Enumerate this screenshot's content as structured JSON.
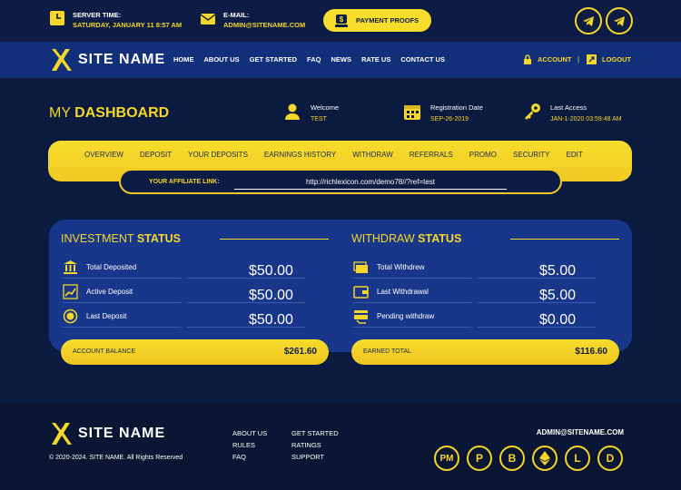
{
  "topbar": {
    "server_time_label": "SERVER TIME:",
    "server_time_value": "SATURDAY, JANUARY 11 8:57 AM",
    "email_label": "E-MAIL:",
    "email_value": "ADMIN@SITENAME.COM",
    "payment_proofs": "PAYMENT PROOFS"
  },
  "brand": {
    "name": "SITE NAME"
  },
  "nav": {
    "items": [
      "HOME",
      "ABOUT US",
      "GET STARTED",
      "FAQ",
      "NEWS",
      "RATE US",
      "CONTACT US"
    ],
    "account": "ACCOUNT",
    "separator": "|",
    "logout": "LOGOUT"
  },
  "dashboard": {
    "title_light": "MY",
    "title_bold": "DASHBOARD",
    "welcome_label": "Welcome",
    "welcome_value": "TEST",
    "reg_label": "Registration Date",
    "reg_value": "SEP-26-2019",
    "last_label": "Last Access",
    "last_value": "JAN-1-2020 03:59:48 AM"
  },
  "tabs": [
    "OVERVIEW",
    "DEPOSIT",
    "YOUR DEPOSITS",
    "EARNINGS HISTORY",
    "WITHDRAW",
    "REFERRALS",
    "PROMO",
    "SECURITY",
    "EDIT"
  ],
  "affiliate": {
    "label": "YOUR AFFILIATE LINK:",
    "link": "http://richlexicon.com/demo78//?ref=test"
  },
  "investment": {
    "title_light": "INVESTMENT",
    "title_bold": "STATUS",
    "rows": [
      {
        "label": "Total Deposited",
        "value": "$50.00",
        "icon": "bank-icon"
      },
      {
        "label": "Active Deposit",
        "value": "$50.00",
        "icon": "growth-chart-icon"
      },
      {
        "label": "Last Deposit",
        "value": "$50.00",
        "icon": "coin-icon"
      }
    ],
    "total_label": "ACCOUNT BALANCE",
    "total_value": "$261.60"
  },
  "withdraw": {
    "title_light": "WITHDRAW",
    "title_bold": "STATUS",
    "rows": [
      {
        "label": "Total Withdrew",
        "value": "$5.00",
        "icon": "money-stack-icon"
      },
      {
        "label": "Last Withdrawal",
        "value": "$5.00",
        "icon": "wallet-icon"
      },
      {
        "label": "Pending withdraw",
        "value": "$0.00",
        "icon": "card-payment-icon"
      }
    ],
    "total_label": "EARNED TOTAL",
    "total_value": "$116.60"
  },
  "footer": {
    "col1": [
      "ABOUT US",
      "RULES",
      "FAQ"
    ],
    "col2": [
      "GET STARTED",
      "RATINGS",
      "SUPPORT"
    ],
    "copyright": "© 2020-2024. SITE NAME. All Rights Reserved",
    "email": "ADMIN@SITENAME.COM",
    "coins": [
      "PM",
      "P",
      "B",
      "E",
      "L",
      "D"
    ]
  },
  "colors": {
    "accent": "#f5d629",
    "bg": "#0b1a3f",
    "navbar": "#12307a",
    "panel": "#18378a"
  }
}
